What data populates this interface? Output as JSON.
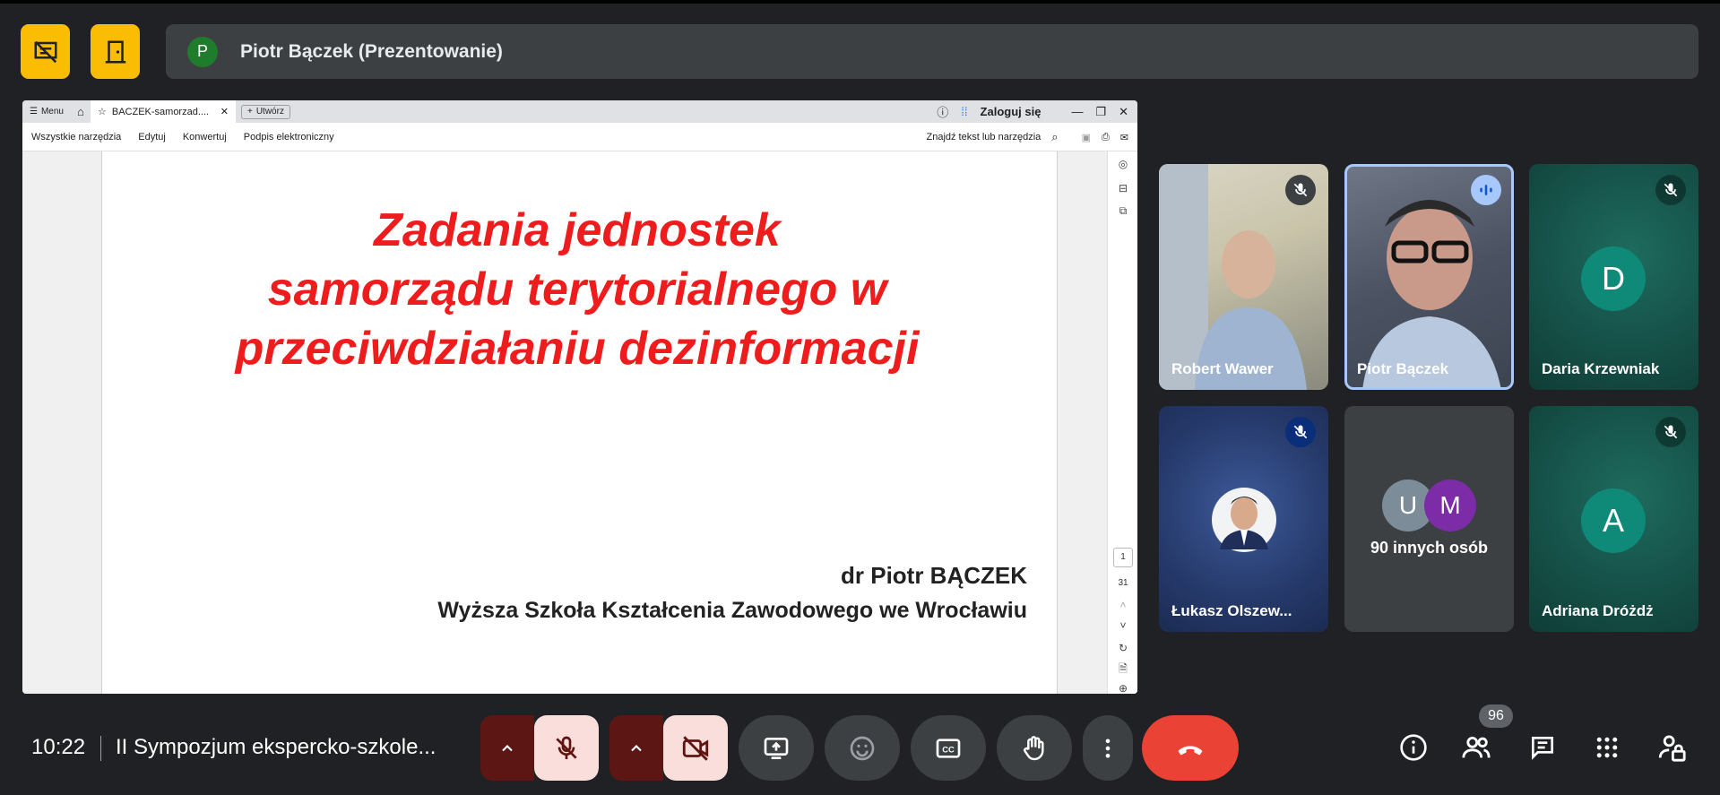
{
  "top": {
    "presenter_initial": "P",
    "presenter_label": "Piotr Bączek (Prezentowanie)"
  },
  "screen": {
    "browser": {
      "menu": "Menu",
      "tab_title": "BACZEK-samorzad....",
      "new_tab": "Utwórz",
      "login": "Zaloguj się"
    },
    "toolbar": {
      "tools": [
        "Wszystkie narzędzia",
        "Edytuj",
        "Konwertuj",
        "Podpis elektroniczny"
      ],
      "search": "Znajdź tekst lub narzędzia"
    },
    "slide": {
      "title_lines": [
        "Zadania jednostek",
        "samorządu terytorialnego w",
        "przeciwdziałaniu dezinformacji"
      ],
      "author": "dr Piotr BĄCZEK",
      "institution": "Wyższa Szkoła Kształcenia Zawodowego we Wrocławiu",
      "title_color": "#ee1c1c"
    },
    "pager": {
      "current": "1",
      "total": "31"
    }
  },
  "participants": [
    {
      "name": "Robert Wawer",
      "muted": true,
      "type": "video"
    },
    {
      "name": "Piotr Bączek",
      "muted": false,
      "speaking": true,
      "type": "video"
    },
    {
      "name": "Daria Krzewniak",
      "muted": true,
      "type": "letter",
      "initial": "D"
    },
    {
      "name": "Łukasz Olszew...",
      "muted": true,
      "type": "photo"
    },
    {
      "name": "90 innych osób",
      "type": "others",
      "initials": [
        "U",
        "M"
      ]
    },
    {
      "name": "Adriana Dróżdż",
      "muted": true,
      "type": "letter",
      "initial": "A"
    }
  ],
  "bottom": {
    "time": "10:22",
    "meeting_title": "II Sympozjum ekspercko-szkole...",
    "participant_count": "96"
  },
  "colors": {
    "background": "#202124",
    "accent_yellow": "#fbbc04",
    "end_call": "#ea4335",
    "muted_control": "#f9dedc",
    "speaking_border": "#a8c7fa"
  }
}
